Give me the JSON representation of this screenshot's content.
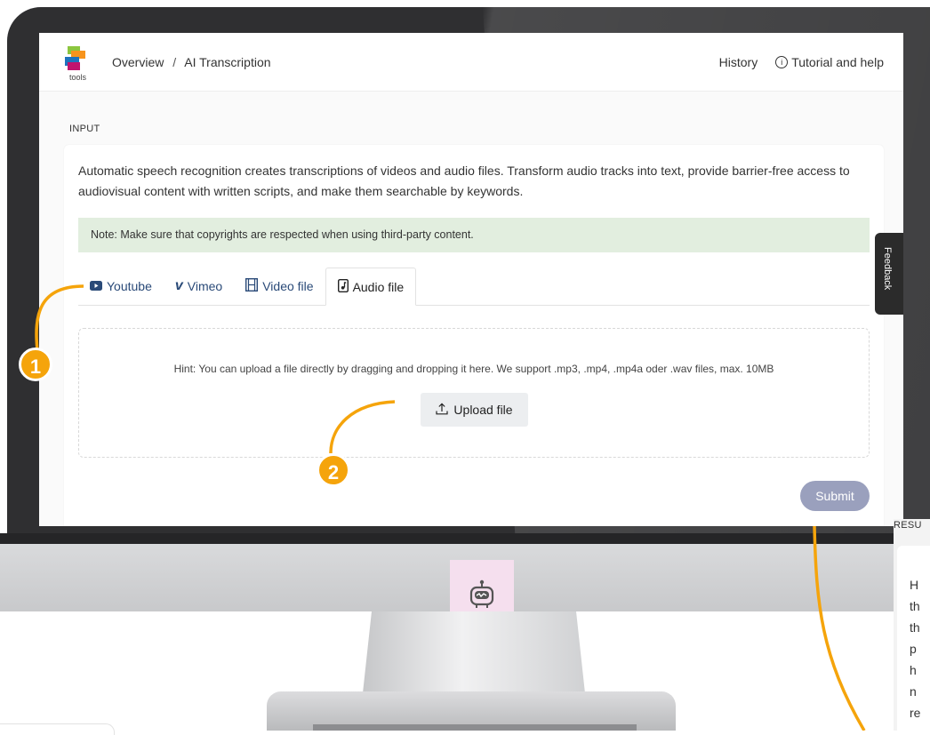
{
  "header": {
    "logo_text": "tools",
    "breadcrumb_root": "Overview",
    "breadcrumb_separator": "/",
    "breadcrumb_current": "AI Transcription",
    "history_label": "History",
    "help_label": "Tutorial and help",
    "help_icon": "info-icon"
  },
  "input": {
    "section_label": "INPUT",
    "description": "Automatic speech recognition creates transcriptions of videos and audio files. Transform audio tracks into text, provide barrier-free access to audiovisual content with written scripts, and make them searchable by keywords.",
    "note": "Note: Make sure that copyrights are respected when using third-party content.",
    "tabs": [
      {
        "label": "Youtube",
        "icon": "youtube-icon"
      },
      {
        "label": "Vimeo",
        "icon": "vimeo-icon"
      },
      {
        "label": "Video file",
        "icon": "film-icon"
      },
      {
        "label": "Audio file",
        "icon": "music-file-icon",
        "active": true
      }
    ],
    "hint": "Hint: You can upload a file directly by dragging and dropping it here. We support .mp3, .mp4, .mp4a oder .wav files, max. 10MB",
    "upload_label": "Upload file",
    "submit_label": "Submit"
  },
  "feedback_label": "Feedback",
  "callouts": [
    "1",
    "2"
  ],
  "results": {
    "label": "RESU",
    "lines": [
      "H",
      "th",
      "th",
      "p",
      "h",
      "n",
      "re"
    ]
  },
  "colors": {
    "accent": "#f5a40b",
    "submit": "#9aa0bd",
    "note_bg": "#e2eedf",
    "tab_text": "#2a4a78"
  }
}
